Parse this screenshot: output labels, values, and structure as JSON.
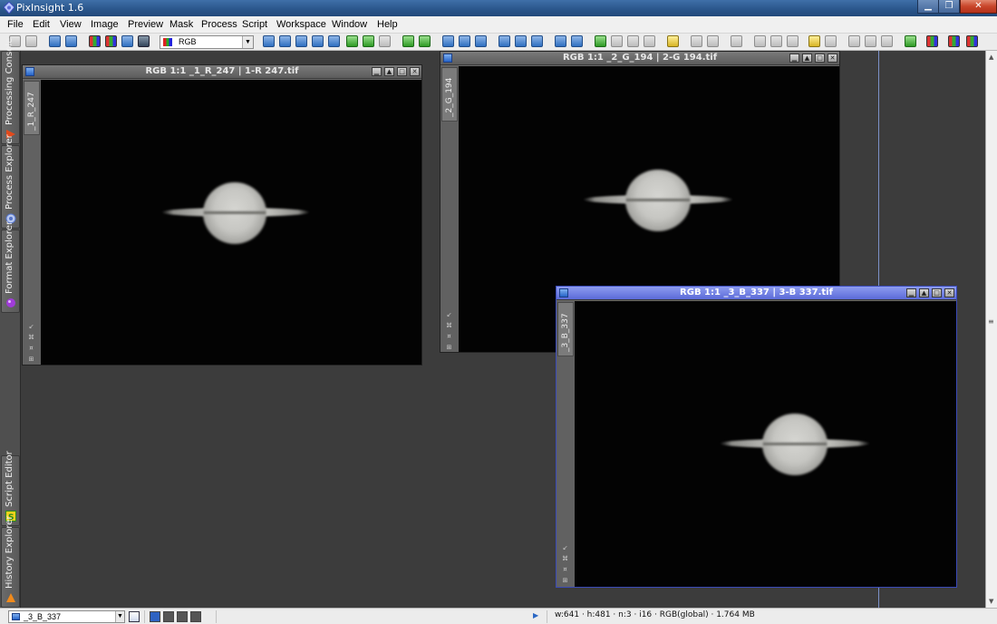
{
  "app": {
    "title": "PixInsight 1.6"
  },
  "menu": [
    "File",
    "Edit",
    "View",
    "Image",
    "Preview",
    "Mask",
    "Process",
    "Script",
    "Workspace",
    "Window",
    "Help"
  ],
  "toolbar": {
    "channel_select": "RGB"
  },
  "left_dock": {
    "tabs": [
      "Processing Console",
      "Process Explorer",
      "Format Explorer",
      "Script Editor",
      "History Explorer"
    ]
  },
  "windows": [
    {
      "title": "RGB 1:1  _1_R_247 | 1-R 247.tif",
      "view_id": "_1_R_247",
      "active": false
    },
    {
      "title": "RGB 1:1  _2_G_194 | 2-G 194.tif",
      "view_id": "_2_G_194",
      "active": false
    },
    {
      "title": "RGB 1:1  _3_B_337 | 3-B 337.tif",
      "view_id": "_3_B_337",
      "active": true
    }
  ],
  "window_buttons": {
    "minimize": "▁",
    "shade": "▲",
    "maximize": "□",
    "close": "✕"
  },
  "status": {
    "current_view": "_3_B_337",
    "info": "w:641 · h:481 · n:3 · i16 · RGB(global) · 1.764 MB"
  },
  "colors": {
    "workspace": "#3c3c3c",
    "active_title": "#5b6ad8",
    "inactive_title": "#6a6a6a",
    "title_bar": "#2a558a"
  }
}
